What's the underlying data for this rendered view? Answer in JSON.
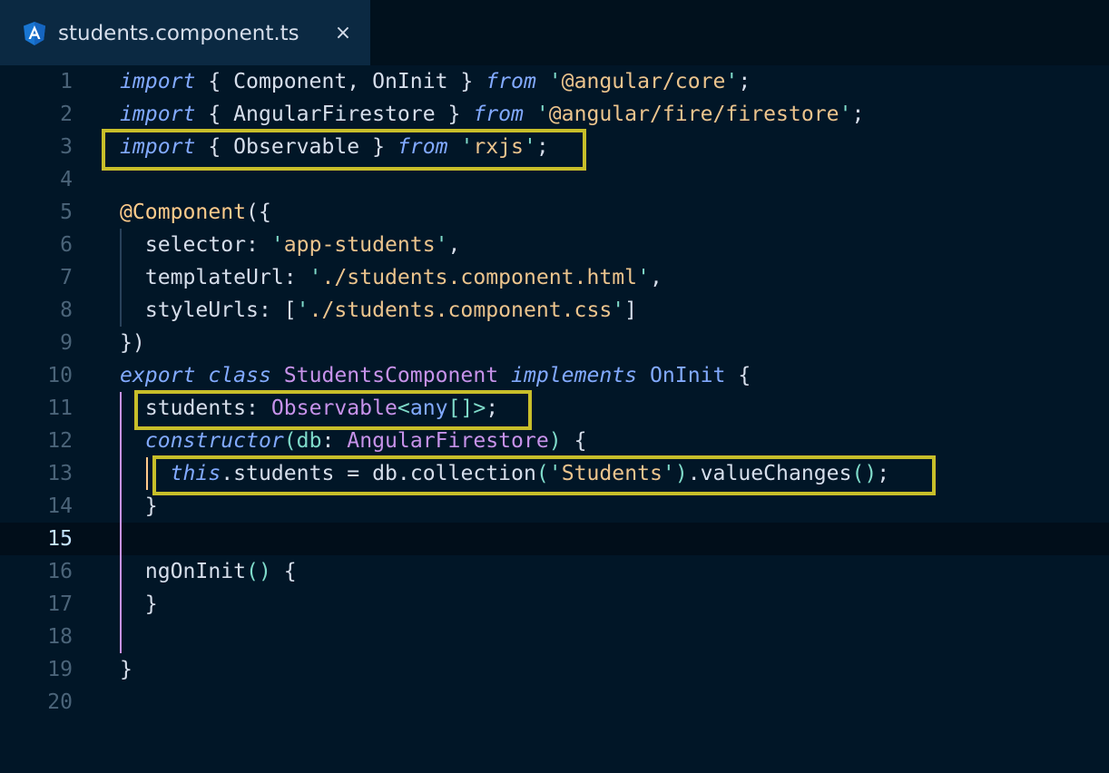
{
  "tab": {
    "title": "students.component.ts",
    "close_label": "×",
    "icon": "angular-icon"
  },
  "editor": {
    "active_line": 15,
    "line_numbers": [
      "1",
      "2",
      "3",
      "4",
      "5",
      "6",
      "7",
      "8",
      "9",
      "10",
      "11",
      "12",
      "13",
      "14",
      "15",
      "16",
      "17",
      "18",
      "19",
      "20"
    ],
    "lines": [
      [
        [
          "kwb",
          "import"
        ],
        [
          "punc",
          " { "
        ],
        [
          "ident",
          "Component"
        ],
        [
          "punc",
          ", "
        ],
        [
          "ident",
          "OnInit"
        ],
        [
          "punc",
          " } "
        ],
        [
          "kwb",
          "from"
        ],
        [
          "punc",
          " "
        ],
        [
          "q",
          "'"
        ],
        [
          "str",
          "@angular/core"
        ],
        [
          "q",
          "'"
        ],
        [
          "punc",
          ";"
        ]
      ],
      [
        [
          "kwb",
          "import"
        ],
        [
          "punc",
          " { "
        ],
        [
          "ident",
          "AngularFirestore"
        ],
        [
          "punc",
          " } "
        ],
        [
          "kwb",
          "from"
        ],
        [
          "punc",
          " "
        ],
        [
          "q",
          "'"
        ],
        [
          "str",
          "@angular/fire/firestore"
        ],
        [
          "q",
          "'"
        ],
        [
          "punc",
          ";"
        ]
      ],
      [
        [
          "kwb",
          "import"
        ],
        [
          "punc",
          " { "
        ],
        [
          "ident",
          "Observable"
        ],
        [
          "punc",
          " } "
        ],
        [
          "kwb",
          "from"
        ],
        [
          "punc",
          " "
        ],
        [
          "q",
          "'"
        ],
        [
          "str",
          "rxjs"
        ],
        [
          "q",
          "'"
        ],
        [
          "punc",
          ";"
        ]
      ],
      [],
      [
        [
          "dec",
          "@Component"
        ],
        [
          "punc",
          "({"
        ]
      ],
      [
        [
          "punc",
          "  "
        ],
        [
          "ident",
          "selector"
        ],
        [
          "punc",
          ": "
        ],
        [
          "q",
          "'"
        ],
        [
          "str",
          "app-students"
        ],
        [
          "q",
          "'"
        ],
        [
          "punc",
          ","
        ]
      ],
      [
        [
          "punc",
          "  "
        ],
        [
          "ident",
          "templateUrl"
        ],
        [
          "punc",
          ": "
        ],
        [
          "q",
          "'"
        ],
        [
          "str",
          "./students.component.html"
        ],
        [
          "q",
          "'"
        ],
        [
          "punc",
          ","
        ]
      ],
      [
        [
          "punc",
          "  "
        ],
        [
          "ident",
          "styleUrls"
        ],
        [
          "punc",
          ": ["
        ],
        [
          "q",
          "'"
        ],
        [
          "str",
          "./students.component.css"
        ],
        [
          "q",
          "'"
        ],
        [
          "punc",
          "]"
        ]
      ],
      [
        [
          "punc",
          "})"
        ]
      ],
      [
        [
          "kwb",
          "export"
        ],
        [
          "punc",
          " "
        ],
        [
          "kwb",
          "class"
        ],
        [
          "punc",
          " "
        ],
        [
          "type",
          "StudentsComponent"
        ],
        [
          "punc",
          " "
        ],
        [
          "kwb",
          "implements"
        ],
        [
          "punc",
          " "
        ],
        [
          "fn",
          "OnInit"
        ],
        [
          "punc",
          " {"
        ]
      ],
      [
        [
          "punc",
          "  "
        ],
        [
          "ident",
          "students"
        ],
        [
          "punc",
          ": "
        ],
        [
          "type",
          "Observable"
        ],
        [
          "q",
          "<"
        ],
        [
          "fn",
          "any"
        ],
        [
          "q",
          "[]>"
        ],
        [
          "punc",
          ";"
        ]
      ],
      [
        [
          "punc",
          "  "
        ],
        [
          "kwb",
          "constructor"
        ],
        [
          "q",
          "("
        ],
        [
          "par",
          "db"
        ],
        [
          "punc",
          ": "
        ],
        [
          "type",
          "AngularFirestore"
        ],
        [
          "q",
          ")"
        ],
        [
          "punc",
          " {"
        ]
      ],
      [
        [
          "punc",
          "    "
        ],
        [
          "this",
          "this"
        ],
        [
          "punc",
          "."
        ],
        [
          "ident",
          "students"
        ],
        [
          "punc",
          " = "
        ],
        [
          "ident",
          "db"
        ],
        [
          "punc",
          "."
        ],
        [
          "ident",
          "collection"
        ],
        [
          "q",
          "("
        ],
        [
          "q",
          "'"
        ],
        [
          "str",
          "Students"
        ],
        [
          "q",
          "'"
        ],
        [
          "q",
          ")"
        ],
        [
          "punc",
          "."
        ],
        [
          "ident",
          "valueChanges"
        ],
        [
          "q",
          "()"
        ],
        [
          "punc",
          ";"
        ]
      ],
      [
        [
          "punc",
          "  }"
        ]
      ],
      [],
      [
        [
          "punc",
          "  "
        ],
        [
          "ident",
          "ngOnInit"
        ],
        [
          "q",
          "()"
        ],
        [
          "punc",
          " {"
        ]
      ],
      [
        [
          "punc",
          "  }"
        ]
      ],
      [],
      [
        [
          "punc",
          "}"
        ]
      ],
      []
    ]
  },
  "colors": {
    "background": "#011627",
    "tab_active": "#0b2942",
    "highlight_box": "#c8be2a",
    "keyword": "#82aaff",
    "string": "#ecc48d",
    "type": "#c792ea"
  }
}
